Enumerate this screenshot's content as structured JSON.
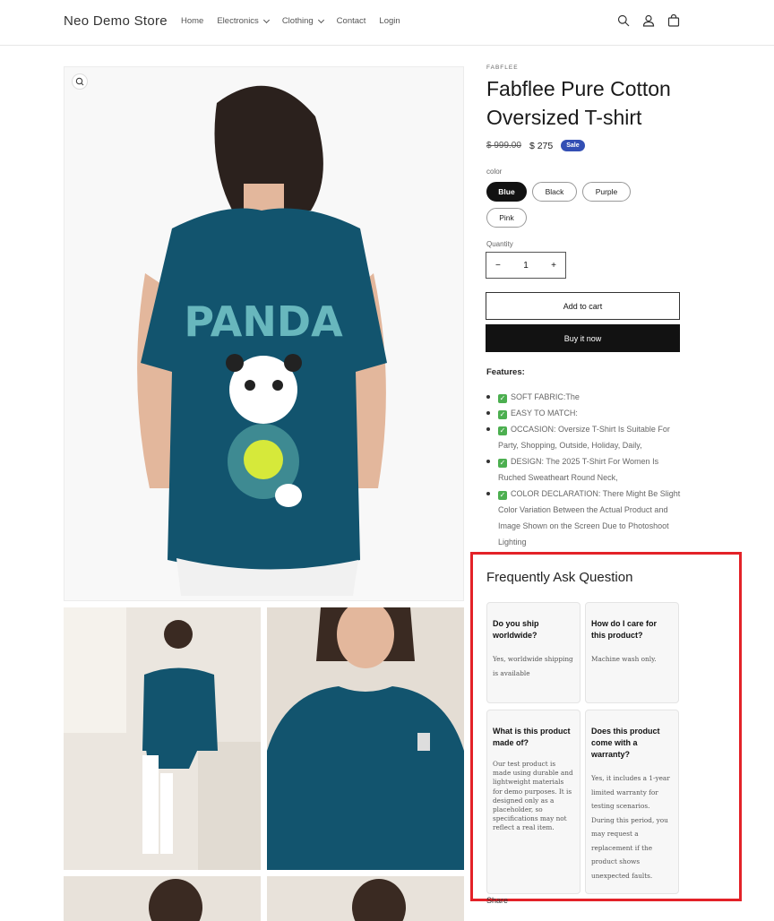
{
  "header": {
    "store_name": "Neo Demo Store",
    "nav": [
      {
        "label": "Home",
        "has_dropdown": false
      },
      {
        "label": "Electronics",
        "has_dropdown": true
      },
      {
        "label": "Clothing",
        "has_dropdown": true
      },
      {
        "label": "Contact",
        "has_dropdown": false
      },
      {
        "label": "Login",
        "has_dropdown": false
      }
    ],
    "icons": [
      "search-icon",
      "account-icon",
      "cart-icon"
    ]
  },
  "gallery": {
    "zoom_icon": "zoom-icon",
    "print_text": "PANDA",
    "tee_color": "#12546e"
  },
  "product": {
    "vendor": "FABFLEE",
    "title": "Fabflee Pure Cotton Oversized T-shirt",
    "price_old": "$ 999.00",
    "price_new": "$ 275",
    "sale_badge": "Sale",
    "color_label": "color",
    "colors": [
      "Blue",
      "Black",
      "Purple",
      "Pink"
    ],
    "selected_color": "Blue",
    "quantity_label": "Quantity",
    "quantity": "1",
    "minus": "−",
    "plus": "+",
    "add_to_cart": "Add to cart",
    "buy_now": "Buy it now",
    "features_heading": "Features:",
    "features": [
      "SOFT FABRIC:The",
      "EASY TO MATCH:",
      "OCCASION: Oversize T-Shirt Is Suitable For Party, Shopping, Outside, Holiday, Daily,",
      "DESIGN: The 2025 T-Shirt For Women Is Ruched Sweatheart Round Neck,",
      "COLOR DECLARATION: There Might Be Slight Color Variation Between the Actual Product and Image Shown on the Screen Due to Photoshoot Lighting"
    ],
    "check_glyph": "✓"
  },
  "faq": {
    "title": "Frequently Ask Question",
    "items": [
      {
        "q": "Do you ship worldwide?",
        "a": "Yes, worldwide shipping is available"
      },
      {
        "q": "How do I care for this product?",
        "a": "Machine wash only."
      },
      {
        "q": "What is this product made of?",
        "a": "Our test product is made using durable and lightweight materials for demo purposes. It is designed only as a placeholder, so specifications may not reflect a real item."
      },
      {
        "q": "Does this product come with a warranty?",
        "a": "Yes, it includes a 1-year limited warranty for testing scenarios. During this period, you may request a replacement if the product shows unexpected faults."
      }
    ]
  },
  "share_label": "Share",
  "colors": {
    "sale": "#334fb4",
    "highlight": "#e32228",
    "dark_button": "#121212"
  }
}
